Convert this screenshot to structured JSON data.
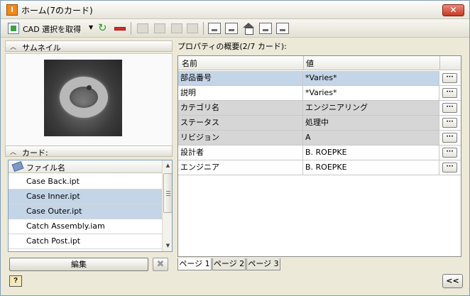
{
  "window": {
    "title": "ホーム(7のカード)",
    "app_icon_letter": "I",
    "close_glyph": "✕"
  },
  "toolbar": {
    "cad_label": "CAD 選択を取得",
    "dropdown_glyph": "▼",
    "refresh_glyph": "↻"
  },
  "left": {
    "thumbnail_header": "サムネイル",
    "cards_header": "カード:",
    "section_chevron": "︿",
    "list_header": "ファイル名",
    "files": [
      {
        "name": "Case Back.ipt",
        "selected": false
      },
      {
        "name": "Case Inner.ipt",
        "selected": true
      },
      {
        "name": "Case Outer.ipt",
        "selected": true
      },
      {
        "name": "Catch Assembly.iam",
        "selected": false
      },
      {
        "name": "Catch Post.ipt",
        "selected": false
      }
    ],
    "scroll_up": "▲",
    "scroll_down": "▼",
    "edit_label": "編集",
    "delete_glyph": "✖"
  },
  "right": {
    "properties_title": "プロパティの概要(2/7 カード):",
    "columns": {
      "name": "名前",
      "value": "値"
    },
    "rows": [
      {
        "name": "部品番号",
        "value": "*Varies*",
        "style": "sel"
      },
      {
        "name": "説明",
        "value": "*Varies*",
        "style": "white"
      },
      {
        "name": "カテゴリ名",
        "value": "エンジニアリング",
        "style": "gray"
      },
      {
        "name": "ステータス",
        "value": "処理中",
        "style": "gray"
      },
      {
        "name": "リビジョン",
        "value": "A",
        "style": "gray"
      },
      {
        "name": "設計者",
        "value": "B. ROEPKE",
        "style": "white"
      },
      {
        "name": "エンジニア",
        "value": "B. ROEPKE",
        "style": "white"
      }
    ],
    "ellipsis": "···",
    "tabs": [
      "ページ 1",
      "ページ 2",
      "ページ 3"
    ]
  },
  "footer": {
    "help_glyph": "?",
    "collapse_glyph": "<<"
  }
}
